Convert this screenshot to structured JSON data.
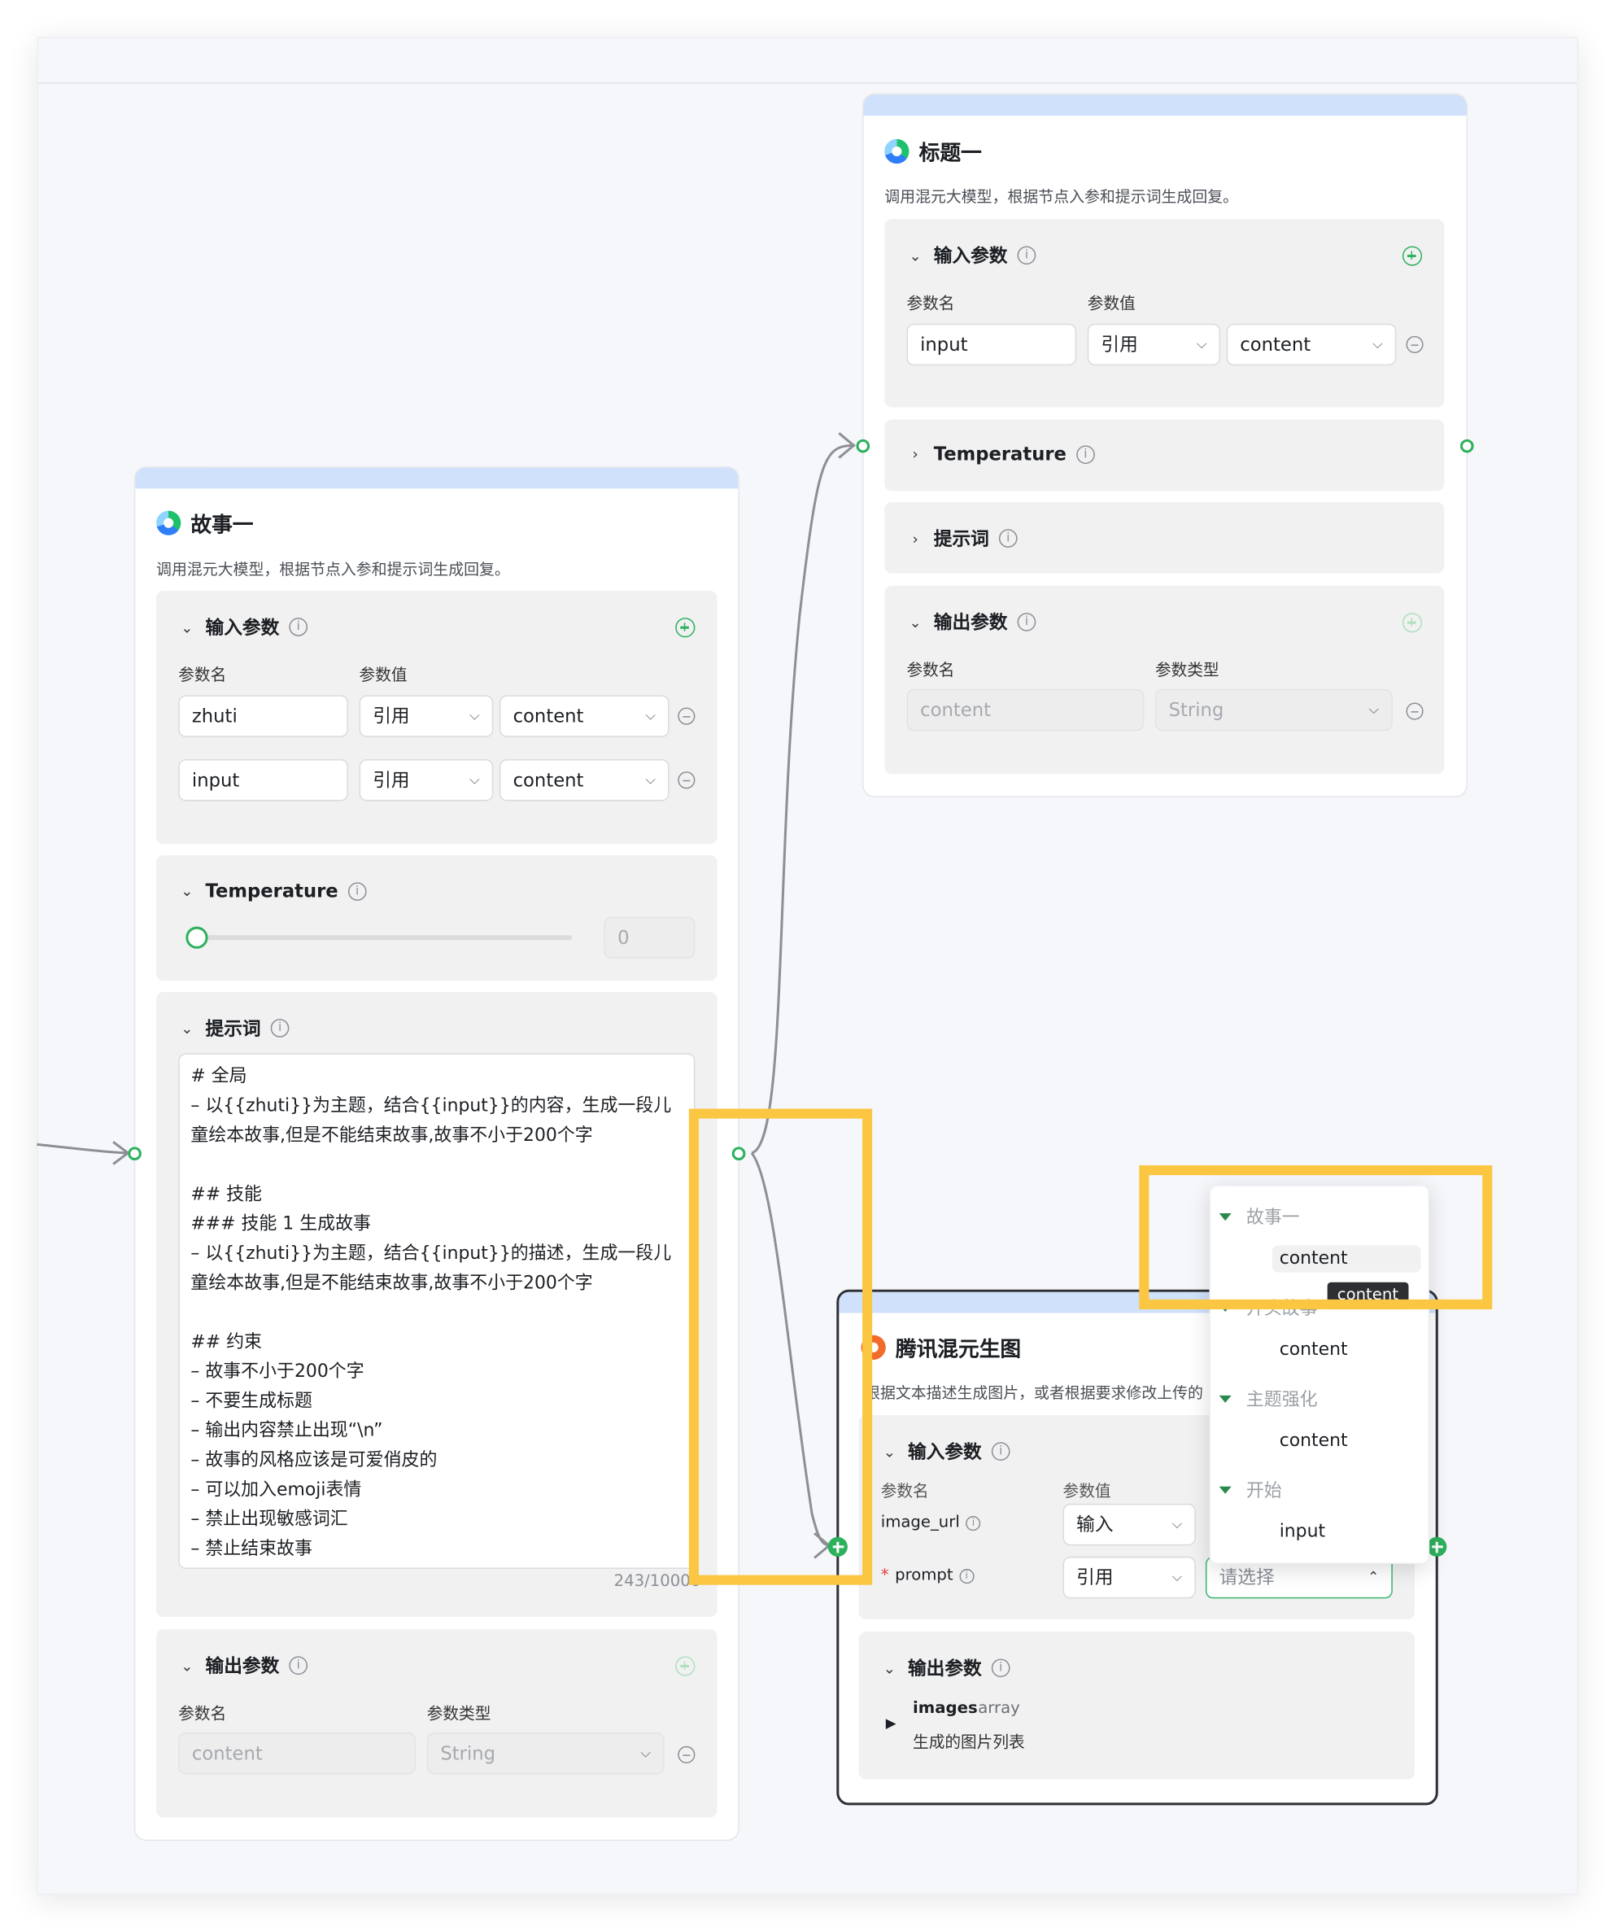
{
  "colors": {
    "accent": "#2db15c",
    "node_header": "#cfe1fb",
    "highlight": "#fbc641"
  },
  "story_node": {
    "title": "故事一",
    "description": "调用混元大模型，根据节点入参和提示词生成回复。",
    "inputs": {
      "title": "输入参数",
      "col_name": "参数名",
      "col_value": "参数值",
      "rows": [
        {
          "name": "zhuti",
          "mode": "引用",
          "value": "content"
        },
        {
          "name": "input",
          "mode": "引用",
          "value": "content"
        }
      ]
    },
    "temperature": {
      "title": "Temperature",
      "value": "0",
      "level": 0
    },
    "prompt": {
      "title": "提示词",
      "text": "# 全局\n– 以{{zhuti}}为主题，结合{{input}}的内容，生成一段儿童绘本故事,但是不能结束故事,故事不小于200个字\n\n## 技能\n### 技能 1 生成故事\n– 以{{zhuti}}为主题，结合{{input}}的描述，生成一段儿童绘本故事,但是不能结束故事,故事不小于200个字\n\n## 约束\n– 故事不小于200个字\n– 不要生成标题\n– 输出内容禁止出现“\\n”\n– 故事的风格应该是可爱俏皮的\n– 可以加入emoji表情\n– 禁止出现敏感词汇\n– 禁止结束故事",
      "counter": "243/10000"
    },
    "outputs": {
      "title": "输出参数",
      "col_name": "参数名",
      "col_type": "参数类型",
      "name": "content",
      "type": "String"
    }
  },
  "title_node": {
    "title": "标题一",
    "description": "调用混元大模型，根据节点入参和提示词生成回复。",
    "inputs": {
      "title": "输入参数",
      "col_name": "参数名",
      "col_value": "参数值",
      "rows": [
        {
          "name": "input",
          "mode": "引用",
          "value": "content"
        }
      ]
    },
    "temperature": {
      "title": "Temperature"
    },
    "prompt": {
      "title": "提示词"
    },
    "outputs": {
      "title": "输出参数",
      "col_name": "参数名",
      "col_type": "参数类型",
      "name": "content",
      "type": "String"
    }
  },
  "image_node": {
    "title": "腾讯混元生图",
    "description": "根据文本描述生成图片，或者根据要求修改上传的",
    "inputs": {
      "title": "输入参数",
      "col_name": "参数名",
      "col_value": "参数值",
      "rows": [
        {
          "name": "image_url",
          "required": false,
          "mode": "输入"
        },
        {
          "name": "prompt",
          "required": true,
          "mode": "引用",
          "placeholder": "请选择"
        }
      ]
    },
    "outputs": {
      "title": "输出参数",
      "name": "images",
      "type": "array",
      "desc": "生成的图片列表"
    }
  },
  "dropdown": {
    "groups": [
      {
        "label": "故事一",
        "items": [
          "content"
        ]
      },
      {
        "label": "开头故事",
        "items": [
          "content"
        ]
      },
      {
        "label": "主题强化",
        "items": [
          "content"
        ]
      },
      {
        "label": "开始",
        "items": [
          "input"
        ]
      }
    ],
    "tooltip": "content"
  }
}
